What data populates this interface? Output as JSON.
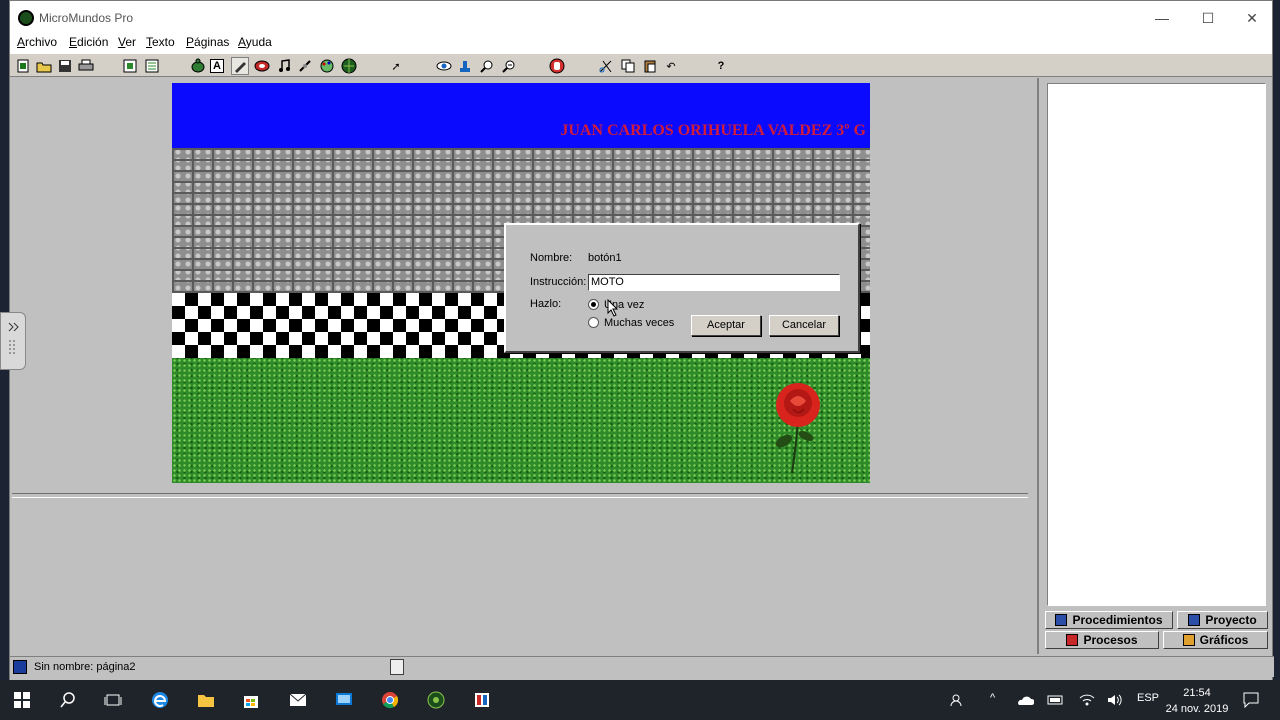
{
  "window": {
    "title": "MicroMundos Pro",
    "minimize": "—",
    "maximize": "☐",
    "close": "✕"
  },
  "menu": [
    "Archivo",
    "Edición",
    "Ver",
    "Texto",
    "Páginas",
    "Ayuda"
  ],
  "toolbar": {
    "icons": [
      "new-page-icon",
      "open-icon",
      "save-icon",
      "print-icon",
      "page-icon",
      "page-list-icon",
      "hatch-turtle-icon",
      "text-box-icon",
      "pen-icon",
      "button-icon",
      "melody-icon",
      "slider-icon",
      "color-palette-icon",
      "globe-icon",
      "pointer-icon",
      "eye-icon",
      "stamp-icon",
      "zoom-in-icon",
      "zoom-out-icon",
      "stop-icon",
      "scissors-icon",
      "copy-icon",
      "paste-icon",
      "undo-icon",
      "help-icon"
    ],
    "glyphs": {
      "pointer": "➚",
      "help": "?",
      "text": "A",
      "undo": "↶",
      "stop": "✋"
    }
  },
  "page": {
    "banner": "JUAN CARLOS ORIHUELA VALDEZ 3º G"
  },
  "dialog": {
    "nombre_label": "Nombre:",
    "nombre_value": "botón1",
    "instruccion_label": "Instrucción:",
    "instruccion_value": "MOTO",
    "hazlo_label": "Hazlo:",
    "option_once": "Una vez",
    "option_many": "Muchas veces",
    "selected": "Una vez",
    "accept": "Aceptar",
    "cancel": "Cancelar"
  },
  "tabs": {
    "procedimientos": "Procedimientos",
    "proyecto": "Proyecto",
    "procesos": "Procesos",
    "graficos": "Gráficos"
  },
  "status": {
    "text": "Sin nombre:  página2"
  },
  "taskbar": {
    "language": "ESP",
    "time": "21:54",
    "date": "24 nov. 2019"
  }
}
